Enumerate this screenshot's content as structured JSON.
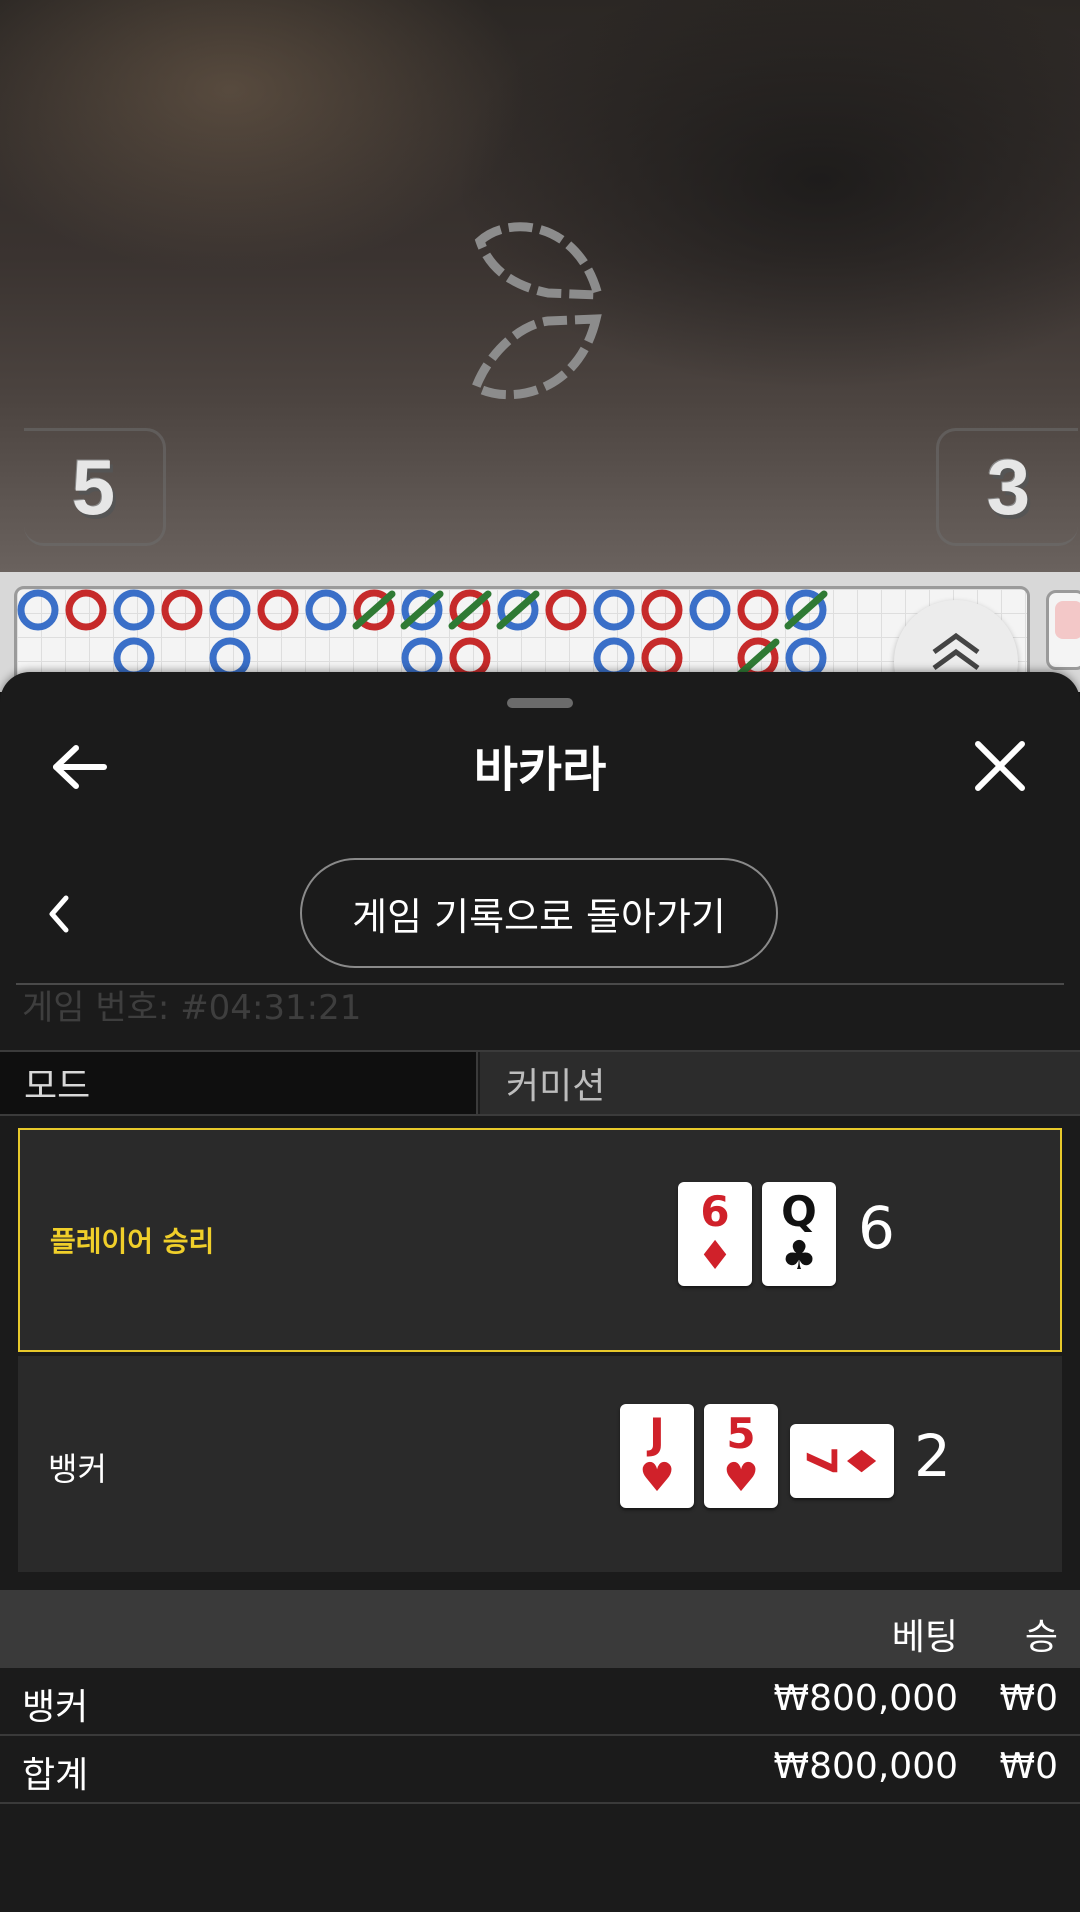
{
  "video": {
    "player_score": "5",
    "banker_score": "3"
  },
  "roadmap": {
    "colors": {
      "banker": "#c62a2a",
      "player": "#3a6fc8",
      "tie": "#2f7a34"
    }
  },
  "sheet": {
    "title": "바카라",
    "back_to_history": "게임 기록으로 돌아가기",
    "game_number": "게임 번호: #04:31:21"
  },
  "mode": {
    "label": "모드",
    "value": "커미션"
  },
  "result": {
    "player": {
      "label": "플레이어 승리",
      "cards": [
        {
          "rank": "6",
          "suit": "♦",
          "color": "red"
        },
        {
          "rank": "Q",
          "suit": "♣",
          "color": "black"
        }
      ],
      "total": "6"
    },
    "banker": {
      "label": "뱅커",
      "cards": [
        {
          "rank": "J",
          "suit": "♥",
          "color": "red"
        },
        {
          "rank": "5",
          "suit": "♥",
          "color": "red"
        },
        {
          "rank": "7",
          "suit": "♦",
          "color": "red",
          "rotated": true
        }
      ],
      "total": "2"
    }
  },
  "bets": {
    "headers": {
      "bet": "베팅",
      "win": "승"
    },
    "rows": [
      {
        "label": "뱅커",
        "bet": "₩800,000",
        "win": "₩0"
      },
      {
        "label": "합계",
        "bet": "₩800,000",
        "win": "₩0"
      }
    ]
  }
}
